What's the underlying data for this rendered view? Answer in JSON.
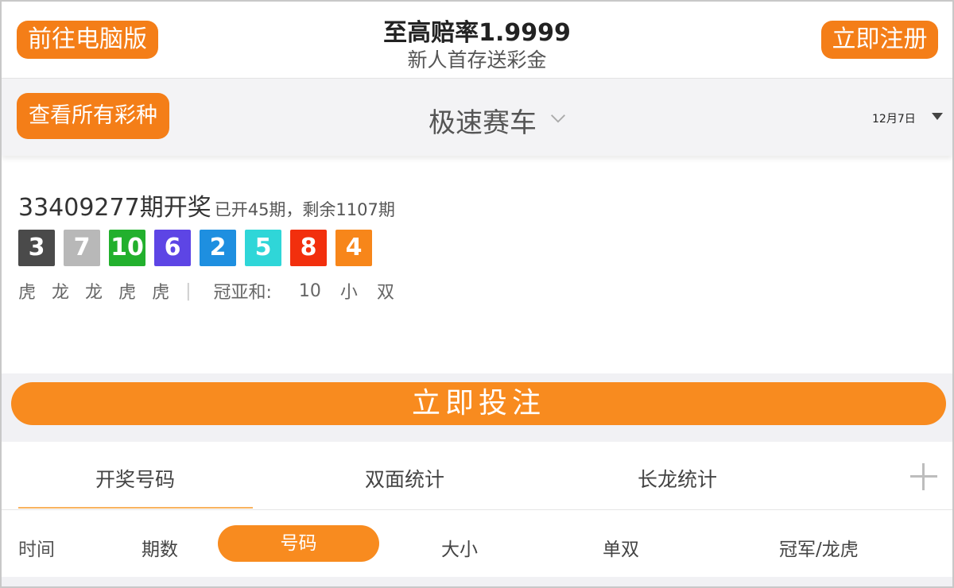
{
  "header": {
    "pc_button": "前往电脑版",
    "title": "至高赔率1.9999",
    "subtitle": "新人首存送彩金",
    "register_button": "立即注册"
  },
  "selector": {
    "all_lotteries_button": "查看所有彩种",
    "lottery_name": "极速赛车",
    "date": "12月7日"
  },
  "result": {
    "issue_title": "33409277期开奖",
    "progress": "已开45期，剩余1107期",
    "balls": [
      {
        "value": "3",
        "color": "#4a4a4a"
      },
      {
        "value": "7",
        "color": "#b8b8b8"
      },
      {
        "value": "10",
        "color": "#22b02d"
      },
      {
        "value": "6",
        "color": "#5d45e5"
      },
      {
        "value": "2",
        "color": "#1e8fe0"
      },
      {
        "value": "5",
        "color": "#2fd6d8"
      },
      {
        "value": "8",
        "color": "#f22f0d"
      },
      {
        "value": "4",
        "color": "#f7861a"
      }
    ],
    "dragon_tiger": [
      "虎",
      "龙",
      "龙",
      "虎",
      "虎"
    ],
    "separator": "|",
    "sum_label": "冠亚和:",
    "sum_value": "10",
    "sum_size": "小",
    "sum_parity": "双"
  },
  "bet_button": "立即投注",
  "tabs": [
    {
      "label": "开奖号码"
    },
    {
      "label": "双面统计"
    },
    {
      "label": "长龙统计"
    }
  ],
  "filters": {
    "time": "时间",
    "issue": "期数",
    "number": "号码",
    "size": "大小",
    "parity": "单双",
    "champion": "冠军/龙虎"
  },
  "colors": {
    "accent": "#f47e18",
    "bet_button": "#f88b1f"
  }
}
